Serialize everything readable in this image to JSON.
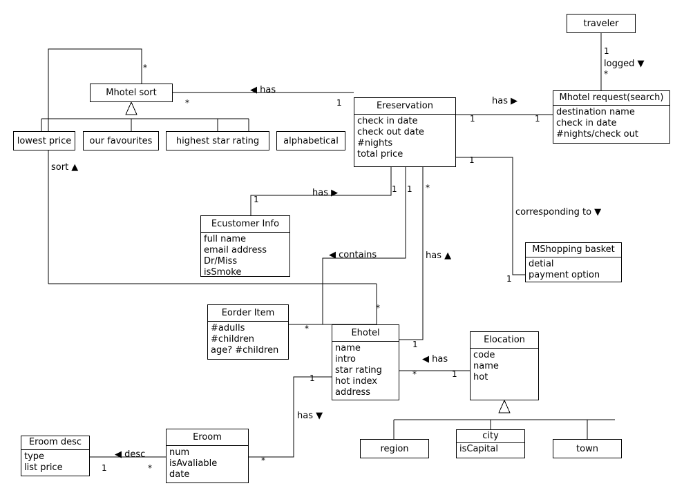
{
  "diagram": {
    "title": "Hotel booking UML class diagram",
    "stroke_color": "#000000",
    "background_color": "#ffffff"
  },
  "classes": {
    "traveler": {
      "name": "traveler",
      "attributes": []
    },
    "mhotel_request": {
      "name": "Mhotel request(search)",
      "attributes": [
        "destination name",
        "check in date",
        "#nights/check out"
      ]
    },
    "mhotel_sort": {
      "name": "Mhotel sort",
      "attributes": []
    },
    "lowest_price": {
      "name": "lowest price",
      "attributes": []
    },
    "our_favourites": {
      "name": "our favourites",
      "attributes": []
    },
    "highest_star": {
      "name": "highest star rating",
      "attributes": []
    },
    "alphabetical": {
      "name": "alphabetical",
      "attributes": []
    },
    "ereservation": {
      "name": "Ereservation",
      "attributes": [
        "check in date",
        "check out date",
        "#nights",
        "total price"
      ]
    },
    "ecustomer_info": {
      "name": "Ecustomer Info",
      "attributes": [
        "full name",
        "email address",
        "Dr/Miss",
        "isSmoke"
      ]
    },
    "mshopping_basket": {
      "name": "MShopping basket",
      "attributes": [
        "detial",
        "payment option"
      ]
    },
    "eorder_item": {
      "name": "Eorder Item",
      "attributes": [
        "#adulls",
        "#children",
        "age? #children"
      ]
    },
    "ehotel": {
      "name": "Ehotel",
      "attributes": [
        "name",
        "intro",
        "star rating",
        "hot index",
        "address"
      ]
    },
    "elocation": {
      "name": "Elocation",
      "attributes": [
        "code",
        "name",
        "hot"
      ]
    },
    "region": {
      "name": "region",
      "attributes": []
    },
    "city": {
      "name": "city",
      "attributes": [
        "isCapital"
      ]
    },
    "town": {
      "name": "town",
      "attributes": []
    },
    "eroom_desc": {
      "name": "Eroom desc",
      "attributes": [
        "type",
        "list price"
      ]
    },
    "eroom": {
      "name": "Eroom",
      "attributes": [
        "num",
        "isAvaliable",
        "date"
      ]
    }
  },
  "associations": [
    {
      "id": "traveler-request",
      "label": "logged ▼",
      "source_mult": "1",
      "target_mult": "*"
    },
    {
      "id": "reservation-request",
      "label": "has ▶",
      "source_mult": "1",
      "target_mult": "1"
    },
    {
      "id": "sort-reservation",
      "label": "◀ has",
      "source_mult": "*",
      "target_mult": "1"
    },
    {
      "id": "reservation-customer",
      "label": "has ▶",
      "source_mult": "1",
      "target_mult": "1"
    },
    {
      "id": "reservation-basket",
      "label": "corresponding to ▼",
      "source_mult": "1",
      "target_mult": "1"
    },
    {
      "id": "reservation-ehotel",
      "label": "has ▲",
      "source_mult": "*",
      "target_mult": "1"
    },
    {
      "id": "reservation-contains",
      "label": "◀ contains",
      "source_mult": "1",
      "target_mult": "*"
    },
    {
      "id": "sort-loop",
      "label": "sort ▲",
      "source_mult": "*",
      "target_mult": ""
    },
    {
      "id": "order-ehotel",
      "label": "",
      "source_mult": "*",
      "target_mult": ""
    },
    {
      "id": "ehotel-location",
      "label": "◀ has",
      "source_mult": "*",
      "target_mult": "1"
    },
    {
      "id": "ehotel-eroom",
      "label": "has ▼",
      "source_mult": "1",
      "target_mult": "*"
    },
    {
      "id": "roomdesc-room",
      "label": "◀ desc",
      "source_mult": "1",
      "target_mult": "*"
    }
  ],
  "multiplicities": {
    "sort_loop_star": "*",
    "sort_star": "*",
    "reservation_left_one": "1",
    "reservation_request_left": "1",
    "reservation_request_right": "1",
    "reservation_basket_top": "1",
    "basket_one": "1",
    "customer_one": "1",
    "reservation_customer_one": "1",
    "reservation_contains_one": "1",
    "reservation_ehotel_star": "*",
    "contains_star": "*",
    "order_star": "*",
    "traveler_one": "1",
    "request_star": "*",
    "ehotel_one": "1",
    "ehotel_loc_star": "*",
    "location_one": "1",
    "ehotel_room_one": "1",
    "eroom_star": "*",
    "roomdesc_one": "1",
    "room_star": "*"
  },
  "labels": {
    "logged": "logged ▼",
    "has_right_request": "has ▶",
    "has_left_sort": "◀ has",
    "has_right_customer": "has ▶",
    "corresponding_to": "corresponding to ▼",
    "has_up_ehotel": "has ▲",
    "contains": "◀ contains",
    "sort": "sort ▲",
    "has_left_location": "◀ has",
    "has_down_room": "has ▼",
    "desc": "◀ desc"
  }
}
